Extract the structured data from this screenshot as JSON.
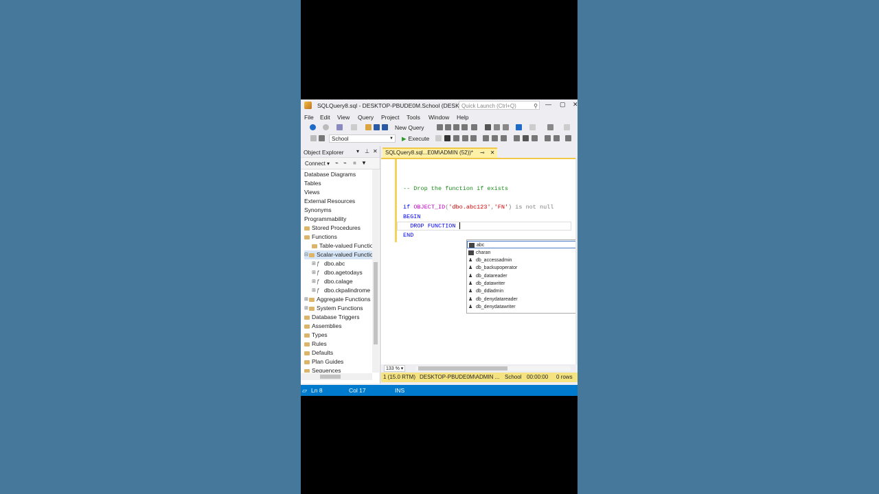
{
  "window": {
    "title": "SQLQuery8.sql - DESKTOP-PBUDE0M.School (DESKT...",
    "quick_launch_placeholder": "Quick Launch (Ctrl+Q)",
    "minimize": "—",
    "maximize": "▢",
    "close": "✕"
  },
  "menu": [
    "File",
    "Edit",
    "View",
    "Query",
    "Project",
    "Tools",
    "Window",
    "Help"
  ],
  "toolbar": {
    "new_query": "New Query",
    "database": "School",
    "execute": "Execute"
  },
  "object_explorer": {
    "title": "Object Explorer",
    "connect": "Connect",
    "nodes": [
      "Database Diagrams",
      "Tables",
      "Views",
      "External Resources",
      "Synonyms",
      "Programmability",
      "Stored Procedures",
      "Functions",
      "Table-valued Functio",
      "Scalar-valued Functio",
      "dbo.abc",
      "dbo.agetodays",
      "dbo.calage",
      "dbo.ckpalindrome",
      "Aggregate Functions",
      "System Functions",
      "Database Triggers",
      "Assemblies",
      "Types",
      "Rules",
      "Defaults",
      "Plan Guides",
      "Sequences"
    ]
  },
  "editor": {
    "tab_label": "SQLQuery8.sql...E0M\\ADMIN (52))*",
    "comment": "-- Drop the function if exists",
    "line_if_kw": "if",
    "line_if_fn": "OBJECT_ID",
    "line_if_str1": "'dbo.abc123'",
    "line_if_str2": "'FN'",
    "line_if_rest": ") is not null",
    "line_begin": "BEGIN",
    "line_drop": "  DROP FUNCTION ",
    "line_end": "END",
    "zoom": "133 %"
  },
  "autocomplete": [
    "abc",
    "charan",
    "db_accessadmin",
    "db_backupoperator",
    "db_datareader",
    "db_datawriter",
    "db_ddladmin",
    "db_denydatareader",
    "db_denydatawriter"
  ],
  "query_status": {
    "version": "1 (15.0 RTM)",
    "server": "DESKTOP-PBUDE0M\\ADMIN ...",
    "database": "School",
    "time": "00:00:00",
    "rows": "0 rows"
  },
  "statusbar": {
    "ln": "Ln 8",
    "col": "Col 17",
    "mode": "INS"
  }
}
